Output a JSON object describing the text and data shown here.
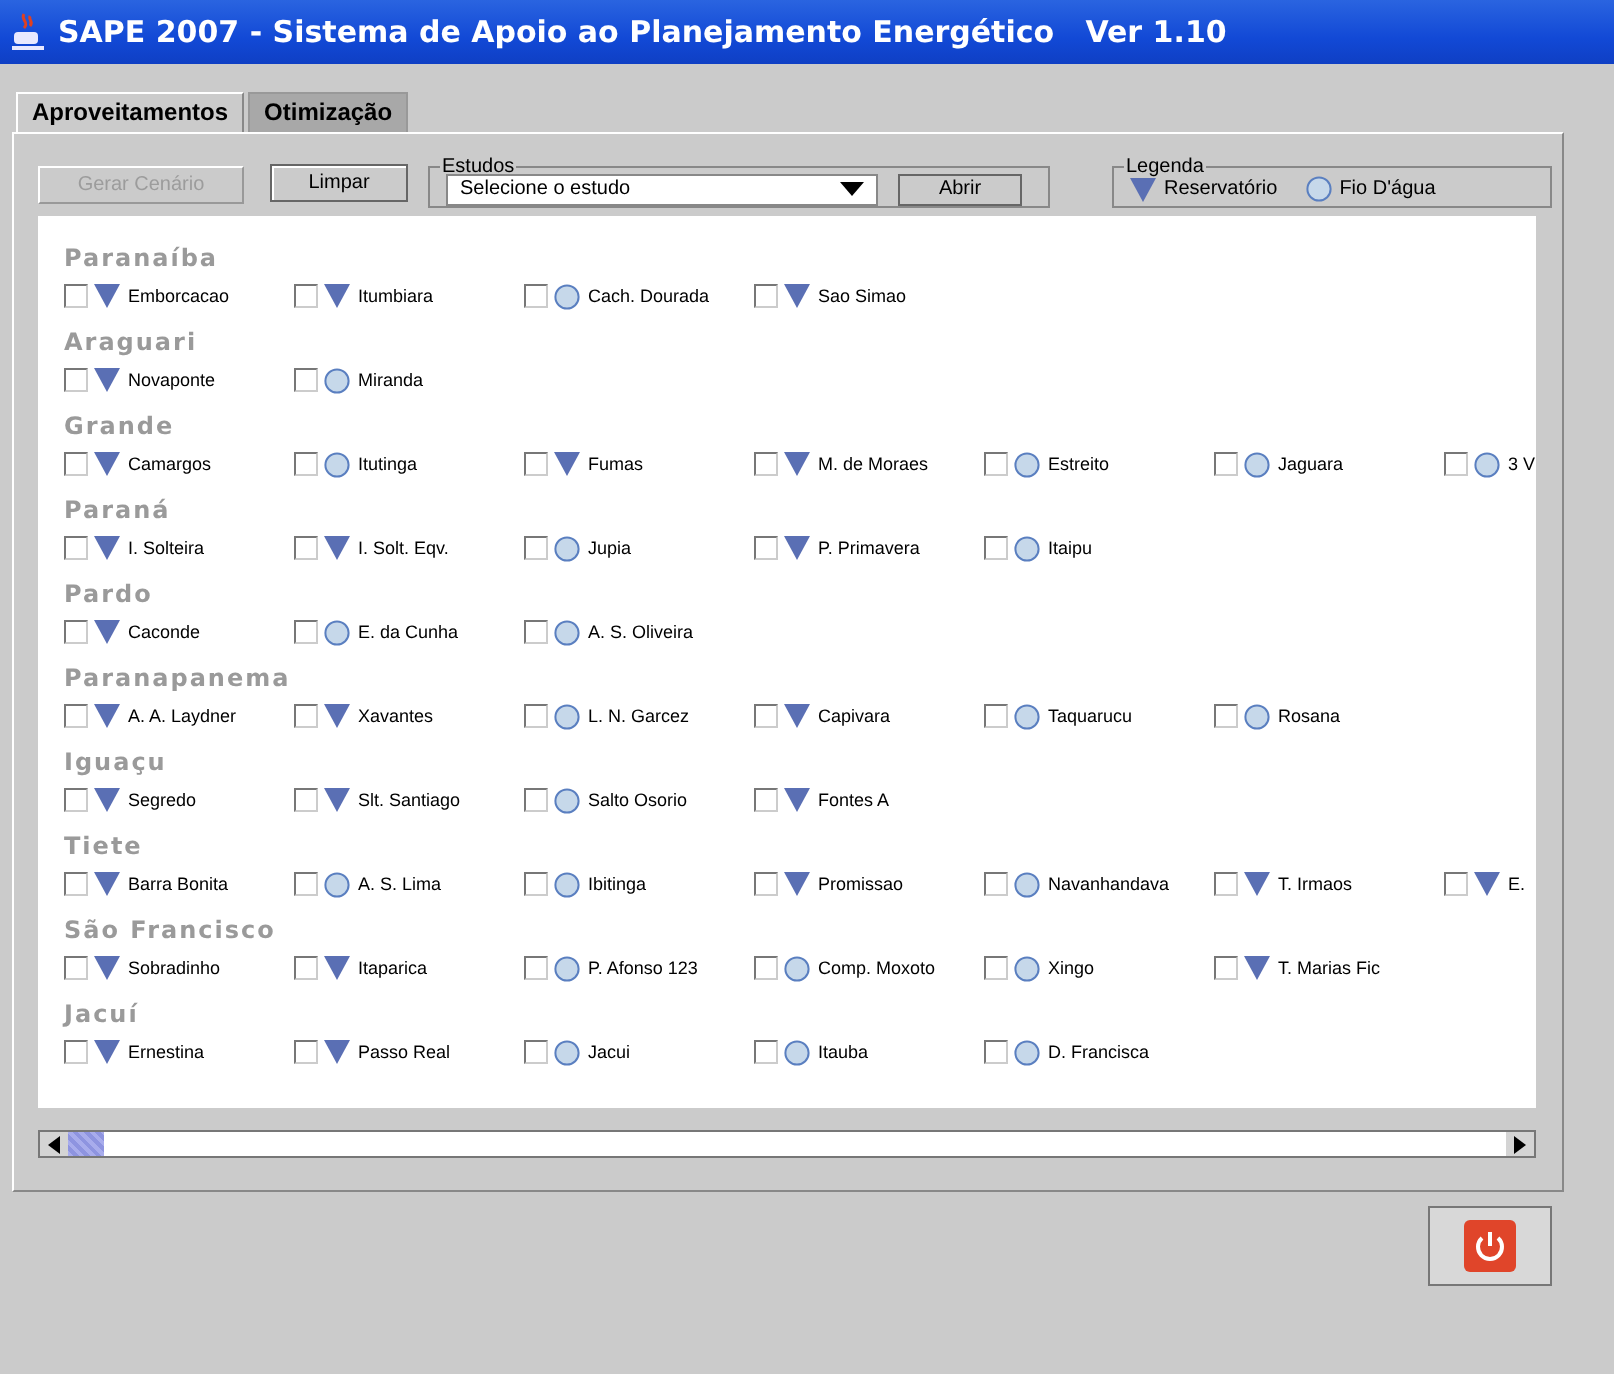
{
  "window": {
    "title": "SAPE 2007 - Sistema de Apoio ao Planejamento Energético   Ver 1.10"
  },
  "tabs": [
    {
      "label": "Aproveitamentos",
      "selected": true
    },
    {
      "label": "Otimização",
      "selected": false
    }
  ],
  "toolbar": {
    "generate_button": {
      "label": "Gerar Cenário",
      "disabled": true
    },
    "clear_button": {
      "label": "Limpar",
      "disabled": false
    },
    "studies": {
      "legend": "Estudos",
      "select_value": "Selecione o estudo",
      "open_button": "Abrir"
    },
    "legend": {
      "title": "Legenda",
      "items": [
        {
          "kind": "reservoir",
          "label": "Reservatório"
        },
        {
          "kind": "run_of_river",
          "label": "Fio D'água"
        }
      ]
    }
  },
  "basins": [
    {
      "name": "Paranaíba",
      "plants": [
        {
          "name": "Emborcacao",
          "kind": "reservoir",
          "checked": false
        },
        {
          "name": "Itumbiara",
          "kind": "reservoir",
          "checked": false
        },
        {
          "name": "Cach. Dourada",
          "kind": "run_of_river",
          "checked": false
        },
        {
          "name": "Sao Simao",
          "kind": "reservoir",
          "checked": false
        }
      ]
    },
    {
      "name": "Araguari",
      "plants": [
        {
          "name": "Novaponte",
          "kind": "reservoir",
          "checked": false
        },
        {
          "name": "Miranda",
          "kind": "run_of_river",
          "checked": false
        }
      ]
    },
    {
      "name": "Grande",
      "plants": [
        {
          "name": "Camargos",
          "kind": "reservoir",
          "checked": false
        },
        {
          "name": "Itutinga",
          "kind": "run_of_river",
          "checked": false
        },
        {
          "name": "Fumas",
          "kind": "reservoir",
          "checked": false
        },
        {
          "name": "M. de Moraes",
          "kind": "reservoir",
          "checked": false
        },
        {
          "name": "Estreito",
          "kind": "run_of_river",
          "checked": false
        },
        {
          "name": "Jaguara",
          "kind": "run_of_river",
          "checked": false
        },
        {
          "name": "3 V",
          "kind": "run_of_river",
          "checked": false
        }
      ]
    },
    {
      "name": "Paraná",
      "plants": [
        {
          "name": "I. Solteira",
          "kind": "reservoir",
          "checked": false
        },
        {
          "name": "I. Solt. Eqv.",
          "kind": "reservoir",
          "checked": false
        },
        {
          "name": "Jupia",
          "kind": "run_of_river",
          "checked": false
        },
        {
          "name": "P. Primavera",
          "kind": "reservoir",
          "checked": false
        },
        {
          "name": "Itaipu",
          "kind": "run_of_river",
          "checked": false
        }
      ]
    },
    {
      "name": "Pardo",
      "plants": [
        {
          "name": "Caconde",
          "kind": "reservoir",
          "checked": false
        },
        {
          "name": "E. da Cunha",
          "kind": "run_of_river",
          "checked": false
        },
        {
          "name": "A. S. Oliveira",
          "kind": "run_of_river",
          "checked": false
        }
      ]
    },
    {
      "name": "Paranapanema",
      "plants": [
        {
          "name": "A. A. Laydner",
          "kind": "reservoir",
          "checked": false
        },
        {
          "name": "Xavantes",
          "kind": "reservoir",
          "checked": false
        },
        {
          "name": "L. N. Garcez",
          "kind": "run_of_river",
          "checked": false
        },
        {
          "name": "Capivara",
          "kind": "reservoir",
          "checked": false
        },
        {
          "name": "Taquarucu",
          "kind": "run_of_river",
          "checked": false
        },
        {
          "name": "Rosana",
          "kind": "run_of_river",
          "checked": false
        }
      ]
    },
    {
      "name": "Iguaçu",
      "plants": [
        {
          "name": "Segredo",
          "kind": "reservoir",
          "checked": false
        },
        {
          "name": "Slt. Santiago",
          "kind": "reservoir",
          "checked": false
        },
        {
          "name": "Salto Osorio",
          "kind": "run_of_river",
          "checked": false
        },
        {
          "name": "Fontes A",
          "kind": "reservoir",
          "checked": false
        }
      ]
    },
    {
      "name": "Tiete",
      "plants": [
        {
          "name": "Barra Bonita",
          "kind": "reservoir",
          "checked": false
        },
        {
          "name": "A. S. Lima",
          "kind": "run_of_river",
          "checked": false
        },
        {
          "name": "Ibitinga",
          "kind": "run_of_river",
          "checked": false
        },
        {
          "name": "Promissao",
          "kind": "reservoir",
          "checked": false
        },
        {
          "name": "Navanhandava",
          "kind": "run_of_river",
          "checked": false
        },
        {
          "name": "T. Irmaos",
          "kind": "reservoir",
          "checked": false
        },
        {
          "name": "E.",
          "kind": "reservoir",
          "checked": false
        }
      ]
    },
    {
      "name": "São Francisco",
      "plants": [
        {
          "name": "Sobradinho",
          "kind": "reservoir",
          "checked": false
        },
        {
          "name": "Itaparica",
          "kind": "reservoir",
          "checked": false
        },
        {
          "name": "P. Afonso 123",
          "kind": "run_of_river",
          "checked": false
        },
        {
          "name": "Comp. Moxoto",
          "kind": "run_of_river",
          "checked": false
        },
        {
          "name": "Xingo",
          "kind": "run_of_river",
          "checked": false
        },
        {
          "name": "T. Marias Fic",
          "kind": "reservoir",
          "checked": false
        }
      ]
    },
    {
      "name": "Jacuí",
      "plants": [
        {
          "name": "Ernestina",
          "kind": "reservoir",
          "checked": false
        },
        {
          "name": "Passo Real",
          "kind": "reservoir",
          "checked": false
        },
        {
          "name": "Jacui",
          "kind": "run_of_river",
          "checked": false
        },
        {
          "name": "Itauba",
          "kind": "run_of_river",
          "checked": false
        },
        {
          "name": "D. Francisca",
          "kind": "run_of_river",
          "checked": false
        }
      ]
    }
  ]
}
